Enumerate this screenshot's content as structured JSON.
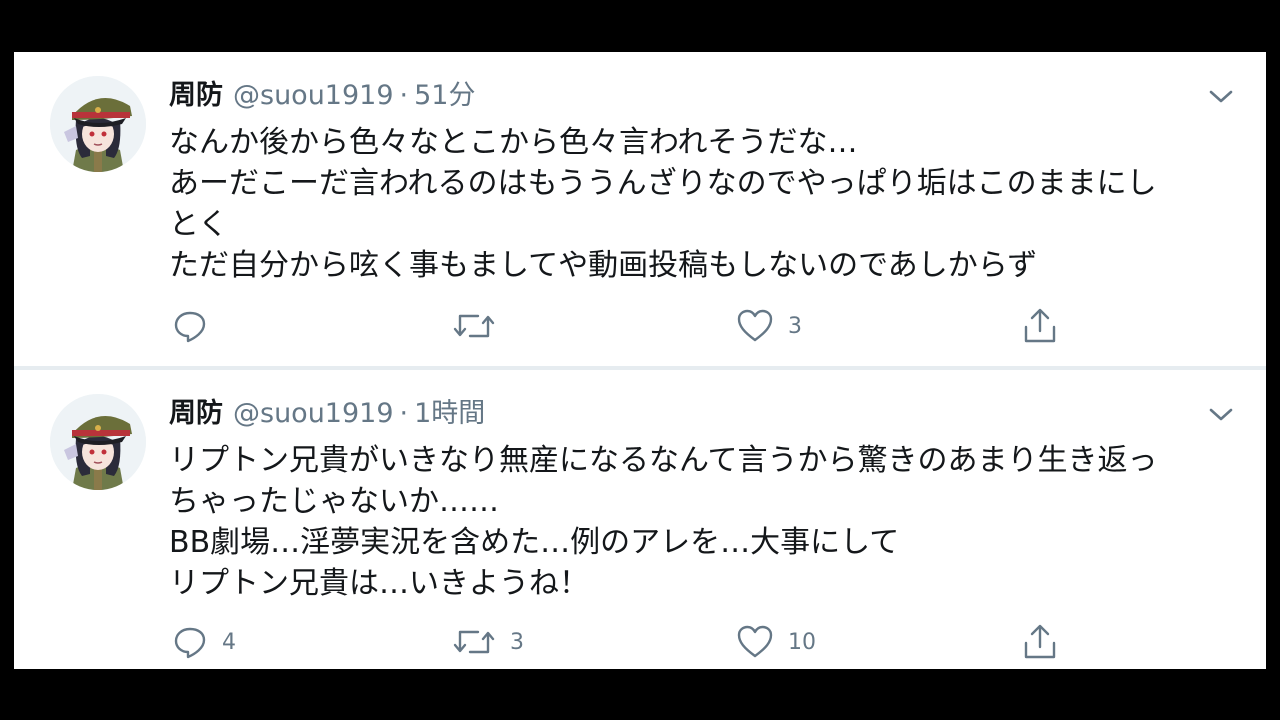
{
  "colors": {
    "background": "#000000",
    "card": "#ffffff",
    "text": "#14171a",
    "secondary": "#657786",
    "divider": "#e6ecf0"
  },
  "tweets": [
    {
      "display_name": "周防",
      "handle": "@suou1919",
      "separator": "·",
      "time": "51分",
      "lines": [
        "なんか後から色々なとこから色々言われそうだな…",
        "あーだこーだ言われるのはもううんざりなのでやっぱり垢はこのままにし",
        "とく",
        "ただ自分から呟く事もましてや動画投稿もしないのであしからず"
      ],
      "actions": {
        "reply_icon": "reply-icon",
        "reply_count": "",
        "retweet_icon": "retweet-icon",
        "retweet_count": "",
        "like_icon": "heart-icon",
        "like_count": "3",
        "share_icon": "share-icon"
      }
    },
    {
      "display_name": "周防",
      "handle": "@suou1919",
      "separator": "·",
      "time": "1時間",
      "lines": [
        "リプトン兄貴がいきなり無産になるなんて言うから驚きのあまり生き返っ",
        "ちゃったじゃないか……",
        "BB劇場…淫夢実況を含めた…例のアレを…大事にして",
        "リプトン兄貴は…いきようね！"
      ],
      "actions": {
        "reply_icon": "reply-icon",
        "reply_count": "4",
        "retweet_icon": "retweet-icon",
        "retweet_count": "3",
        "like_icon": "heart-icon",
        "like_count": "10",
        "share_icon": "share-icon"
      }
    }
  ]
}
